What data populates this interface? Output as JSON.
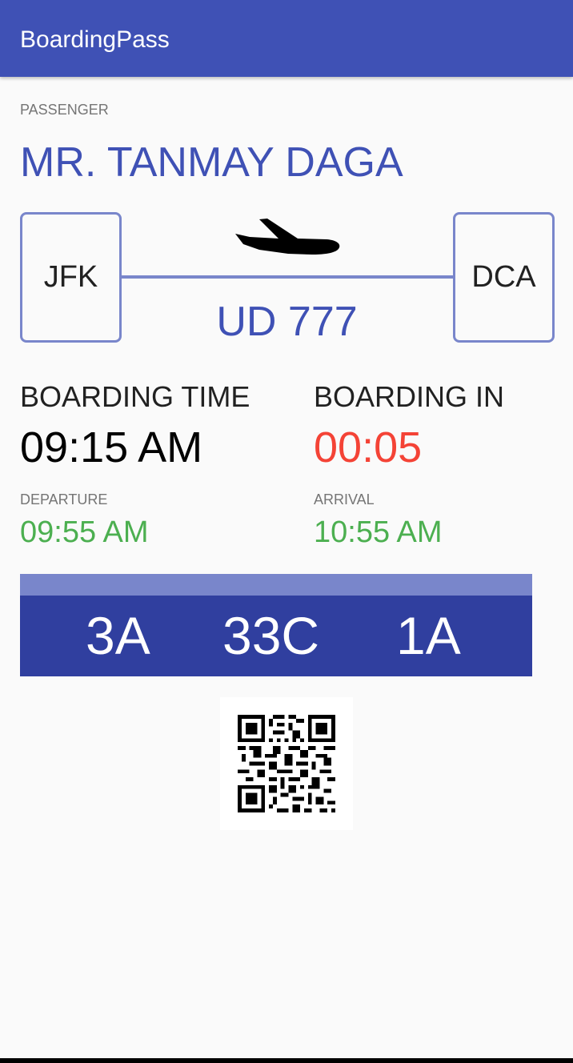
{
  "app": {
    "title": "BoardingPass"
  },
  "passenger": {
    "label": "PASSENGER",
    "name": "MR. TANMAY DAGA"
  },
  "flight": {
    "origin": "JFK",
    "destination": "DCA",
    "number": "UD 777"
  },
  "boarding": {
    "time_label": "BOARDING TIME",
    "time_value": "09:15 AM",
    "in_label": "BOARDING IN",
    "in_value": "00:05"
  },
  "schedule": {
    "departure_label": "DEPARTURE",
    "departure_value": "09:55 AM",
    "arrival_label": "ARRIVAL",
    "arrival_value": "10:55 AM"
  },
  "seats": [
    "3A",
    "33C",
    "1A"
  ],
  "icons": {
    "plane": "airplane-icon",
    "qr": "qr-code"
  },
  "colors": {
    "primary": "#3f51b5",
    "primary_light": "#7986cb",
    "primary_dark": "#303f9f",
    "countdown": "#f44336",
    "time_green": "#4caf50"
  }
}
